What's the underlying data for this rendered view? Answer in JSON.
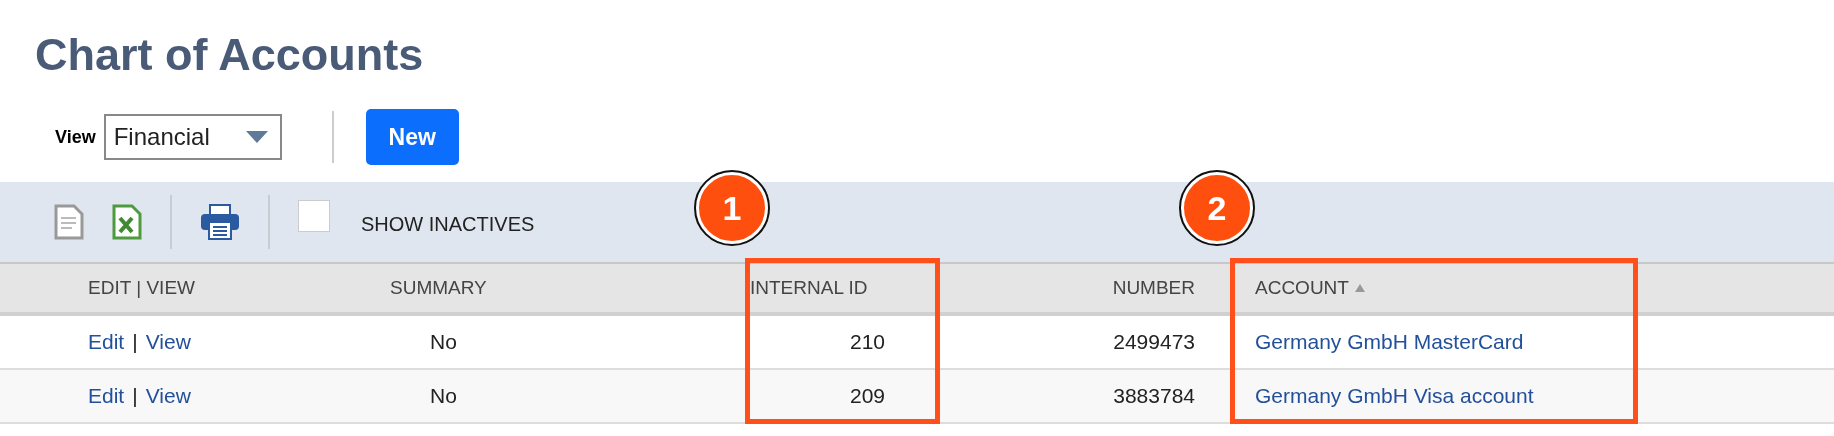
{
  "title": "Chart of Accounts",
  "view": {
    "label": "View",
    "value": "Financial"
  },
  "new_button": "New",
  "toolbar": {
    "show_inactives": {
      "label": "SHOW INACTIVES",
      "checked": false
    }
  },
  "table": {
    "columns": [
      {
        "label": "EDIT | VIEW",
        "kind": "actions"
      },
      {
        "label": "SUMMARY",
        "kind": "center"
      },
      {
        "label": "INTERNAL ID",
        "kind": "right",
        "callout": "1"
      },
      {
        "label": "NUMBER",
        "kind": "right"
      },
      {
        "label": "ACCOUNT",
        "kind": "link",
        "sorted": true,
        "callout": "2"
      }
    ],
    "rows": [
      {
        "edit": "Edit",
        "separator": "|",
        "view": "View",
        "summary": "No",
        "internal_id": "210",
        "number": "2499473",
        "account": "Germany GmbH MasterCard"
      },
      {
        "edit": "Edit",
        "separator": "|",
        "view": "View",
        "summary": "No",
        "internal_id": "209",
        "number": "3883784",
        "account": "Germany GmbH Visa account"
      }
    ]
  }
}
